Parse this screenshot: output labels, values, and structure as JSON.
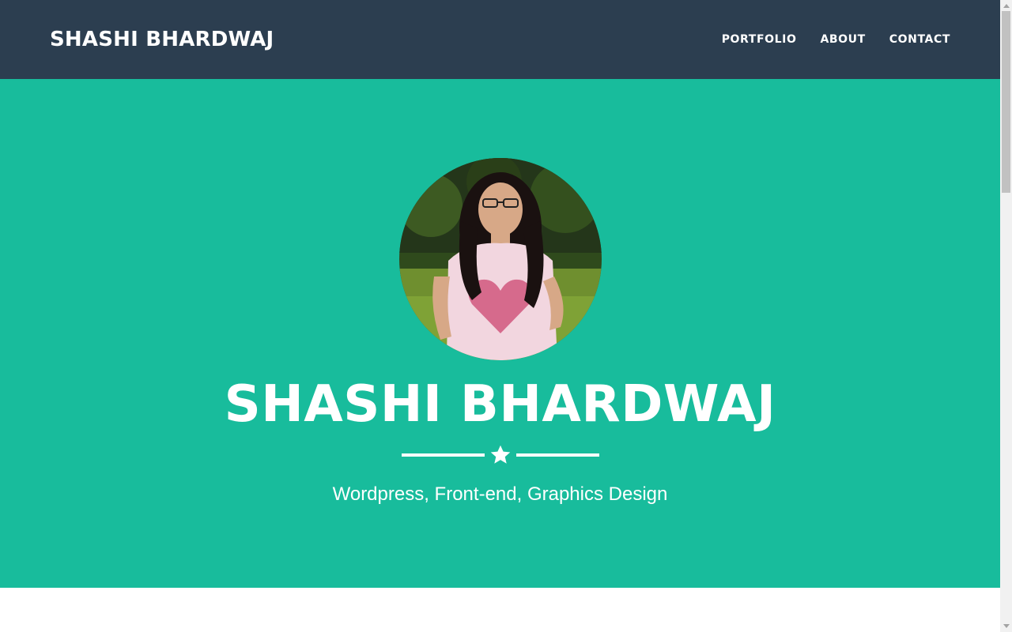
{
  "navbar": {
    "brand": "SHASHI BHARDWAJ",
    "links": [
      {
        "label": "PORTFOLIO"
      },
      {
        "label": "ABOUT"
      },
      {
        "label": "CONTACT"
      }
    ]
  },
  "hero": {
    "title": "SHASHI BHARDWAJ",
    "subtitle": "Wordpress, Front-end, Graphics Design",
    "avatar_icon": "profile-photo",
    "divider_icon": "star-icon"
  },
  "colors": {
    "navbar_bg": "#2c3e50",
    "hero_bg": "#18bc9c",
    "text": "#ffffff"
  }
}
